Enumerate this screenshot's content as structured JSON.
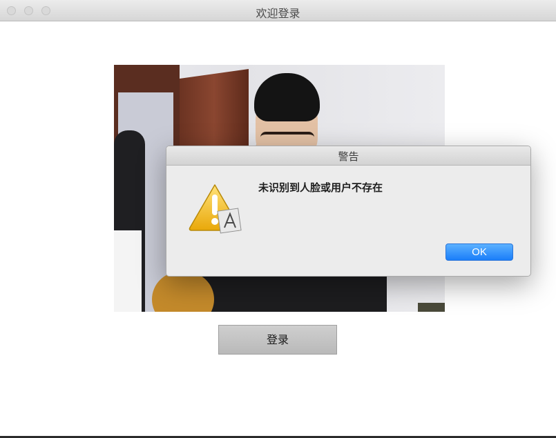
{
  "window": {
    "title": "欢迎登录"
  },
  "main": {
    "camera_preview": "camera-feed",
    "login_button_label": "登录"
  },
  "alert": {
    "title": "警告",
    "message": "未识别到人脸或用户不存在",
    "ok_label": "OK",
    "icon": "warning-icon"
  },
  "colors": {
    "accent": "#1a7ef9",
    "warning": "#f3bf1b"
  }
}
